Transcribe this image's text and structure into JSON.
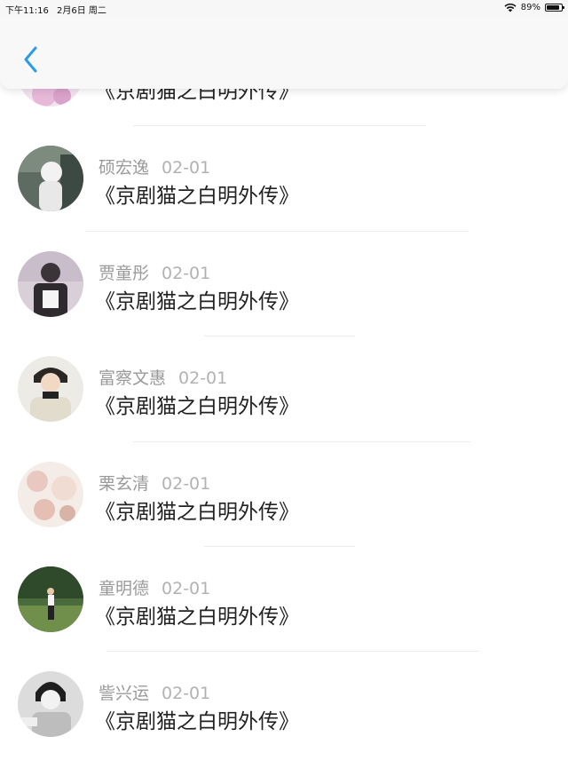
{
  "status_bar": {
    "time": "下午11:16",
    "date": "2月6日 周二",
    "battery": "89%",
    "battery_level": 0.89
  },
  "navbar": {
    "back_icon": "chevron-left-icon",
    "accent": "#2b9be8"
  },
  "list": {
    "items": [
      {
        "name": "",
        "date": "",
        "title": "《京剧猫之白明外传》"
      },
      {
        "name": "硕宏逸",
        "date": "02-01",
        "title": "《京剧猫之白明外传》"
      },
      {
        "name": "贾童彤",
        "date": "02-01",
        "title": "《京剧猫之白明外传》"
      },
      {
        "name": "富察文惠",
        "date": "02-01",
        "title": "《京剧猫之白明外传》"
      },
      {
        "name": "栗玄清",
        "date": "02-01",
        "title": "《京剧猫之白明外传》"
      },
      {
        "name": "童明德",
        "date": "02-01",
        "title": "《京剧猫之白明外传》"
      },
      {
        "name": "訾兴运",
        "date": "02-01",
        "title": "《京剧猫之白明外传》"
      }
    ]
  }
}
